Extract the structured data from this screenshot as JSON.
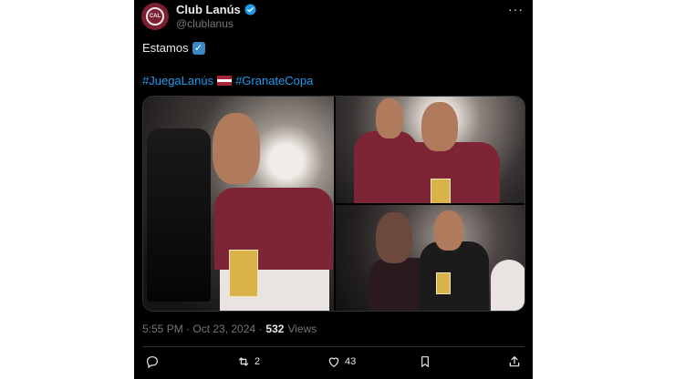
{
  "post": {
    "author_name": "Club Lanús",
    "author_handle": "@clublanus",
    "avatar_initials": "CAL",
    "more_label": "···",
    "text_line1": "Estamos",
    "check_symbol": "✓",
    "hashtags": [
      "#JuegaLanús",
      "#GranateCopa"
    ],
    "time": "5:55 PM · Oct 23, 2024 ·",
    "views_count": "532",
    "views_label": "Views",
    "reposts_count": "2",
    "likes_count": "43"
  },
  "colors": {
    "accent": "#1d9bf0",
    "club_maroon": "#7d2435",
    "background": "#000000",
    "muted": "#71767b"
  },
  "icons": [
    "verified-badge-icon",
    "reply-icon",
    "repost-icon",
    "like-icon",
    "bookmark-icon",
    "share-icon",
    "latvia-flag-icon",
    "check-mark-icon"
  ]
}
